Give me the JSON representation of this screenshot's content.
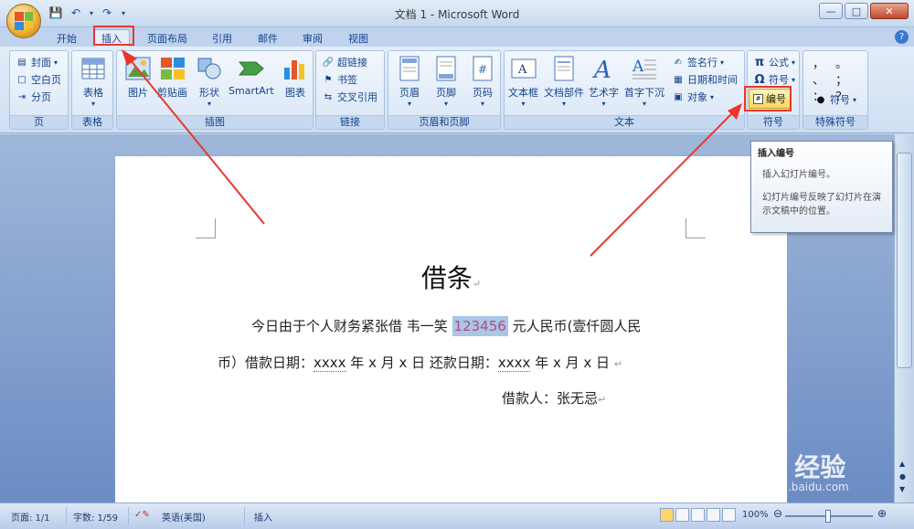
{
  "window": {
    "title": "文档 1 - Microsoft Word"
  },
  "qat": {
    "save": "save-icon",
    "undo": "undo-icon",
    "redo": "redo-icon"
  },
  "tabs": [
    {
      "label": "开始"
    },
    {
      "label": "插入"
    },
    {
      "label": "页面布局"
    },
    {
      "label": "引用"
    },
    {
      "label": "邮件"
    },
    {
      "label": "审阅"
    },
    {
      "label": "视图"
    }
  ],
  "ribbon": {
    "pages": {
      "label": "页",
      "items": [
        "封面",
        "空白页",
        "分页"
      ]
    },
    "tables": {
      "label": "表格",
      "items": [
        "表格"
      ]
    },
    "illustrations": {
      "label": "插图",
      "items": [
        "图片",
        "剪贴画",
        "形状",
        "SmartArt",
        "图表"
      ]
    },
    "links": {
      "label": "链接",
      "items": [
        "超链接",
        "书签",
        "交叉引用"
      ]
    },
    "header_footer": {
      "label": "页眉和页脚",
      "items": [
        "页眉",
        "页脚",
        "页码"
      ]
    },
    "text": {
      "label": "文本",
      "items": [
        "文本框",
        "文档部件",
        "艺术字",
        "首字下沉",
        "签名行",
        "日期和时间",
        "对象"
      ]
    },
    "symbols": {
      "label": "符号",
      "items": [
        "公式",
        "符号",
        "编号"
      ]
    },
    "special": {
      "label": "特殊符号",
      "items": [
        "符号"
      ],
      "glyphs": "，  。  、  ；  ：  ？"
    }
  },
  "tooltip": {
    "title": "插入编号",
    "line1": "插入幻灯片编号。",
    "line2": "幻灯片编号反映了幻灯片在演示文稿中的位置。"
  },
  "document": {
    "title": "借条",
    "line1_a": "今日由于个人财务紧张借  韦一笑 ",
    "amount": "123456",
    "line1_b": " 元人民币(壹仟圆人民",
    "line2_a": "币）借款日期：",
    "xxxx1": "xxxx",
    "line2_b": " 年 x 月 x 日  还款日期：",
    "xxxx2": "xxxx",
    "line2_c": " 年 x 月 x 日 ",
    "line3": "借款人：张无忌"
  },
  "status": {
    "page": "页面: 1/1",
    "words": "字数: 1/59",
    "language": "英语(美国)",
    "mode": "插入",
    "zoom": "100%"
  },
  "watermark": {
    "brand": "Bai du 经验",
    "url": "jingyan.baidu.com"
  },
  "colors": {
    "highlight_red": "#e8382e",
    "ribbon_bg": "#dbe7f6"
  }
}
